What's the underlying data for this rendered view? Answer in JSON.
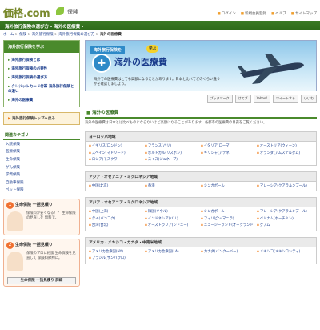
{
  "header": {
    "logo": "価格.com",
    "section": "保険",
    "links": [
      "ログイン",
      "新規会員登録",
      "ヘルプ",
      "サイトマップ"
    ]
  },
  "title_bar": "海外旅行保険の選び方 - 海外の医療費 -",
  "breadcrumb": [
    "ホーム",
    "保険",
    "海外旅行保険",
    "海外旅行保険の選び方",
    "海外の医療費"
  ],
  "sidebar": {
    "head": "海外旅行保険を学ぶ",
    "items": [
      "海外旅行保険とは",
      "海外旅行保険の必要性",
      "海外旅行保険の選び方",
      "クレジットカード付帯 海外旅行保険との違い",
      "海外の医療費"
    ],
    "top_button": "海外旅行保険トップへ戻る",
    "category_head": "関連カテゴリ",
    "categories": [
      "入院保険",
      "医療保険",
      "生命保険",
      "がん保険",
      "学資保険",
      "自動車保険",
      "ペット保険"
    ],
    "promo1": {
      "num": "1",
      "head": "生命保険 一括見積り",
      "text": "保険料が安くなる！？ 生命保険の見直しを 無料で。"
    },
    "promo2": {
      "num": "2",
      "head": "生命保険 一括見積り",
      "text": "保険のプロに相談 生命保険を見直して 保険料節約に。",
      "button": "生命保険 一括見積り 詳細"
    }
  },
  "hero": {
    "tag": "海外旅行保険を",
    "tag2": "学ぶ",
    "title": "海外の医療費",
    "text": "海外での医療費はとても高額になることがあります。日本と比べてどのくらい違うかを確認しましょう。"
  },
  "share": [
    "ブックマーク",
    "はてブ",
    "Yahoo!",
    "ツイートする",
    "いいね"
  ],
  "section": {
    "title": "海外の医療費",
    "intro": "海外の医療費は日本とは比べものにならないほど高額になることがあります。各都市の医療費の目安をご覧ください。"
  },
  "regions": [
    {
      "head": "ヨーロッパ地域",
      "cities": [
        "イギリス(ロンドン)",
        "フランス(パリ)",
        "イタリア(ローマ)",
        "オーストリア(ウィーン)",
        "スペイン(マドリード)",
        "ポルトガル(リスボン)",
        "ギリシャ(アテネ)",
        "オランダ(アムステルダム)",
        "ロシア(モスクワ)",
        "スイス(ジュネーブ)"
      ]
    },
    {
      "head": "アジア・オセアニア・ミクロネシア地域",
      "cities": [
        "中国(北京)",
        "香港",
        "シンガポール",
        "マレーシア(クアラルンプール)"
      ]
    },
    {
      "head": "アジア・オセアニア・ミクロネシア地域",
      "cities": [
        "中国(上海)",
        "韓国(ソウル)",
        "シンガポール",
        "マレーシア(クアラルンプール)",
        "タイ(バンコク)",
        "インドネシア(バリ)",
        "フィリピン(マニラ)",
        "ベトナム(ホーチミン)",
        "台湾(台北)",
        "オーストラリア(シドニー)",
        "ニュージーランド(オークランド)",
        "グアム"
      ]
    },
    {
      "head": "アメリカ・メキシコ・カナダ・中南米地域",
      "cities": [
        "アメリカ合衆国(NY)",
        "アメリカ合衆国(LA)",
        "カナダ(バンクーバー)",
        "メキシコ(メキシコシティ)",
        "ブラジル(サンパウロ)"
      ]
    }
  ]
}
